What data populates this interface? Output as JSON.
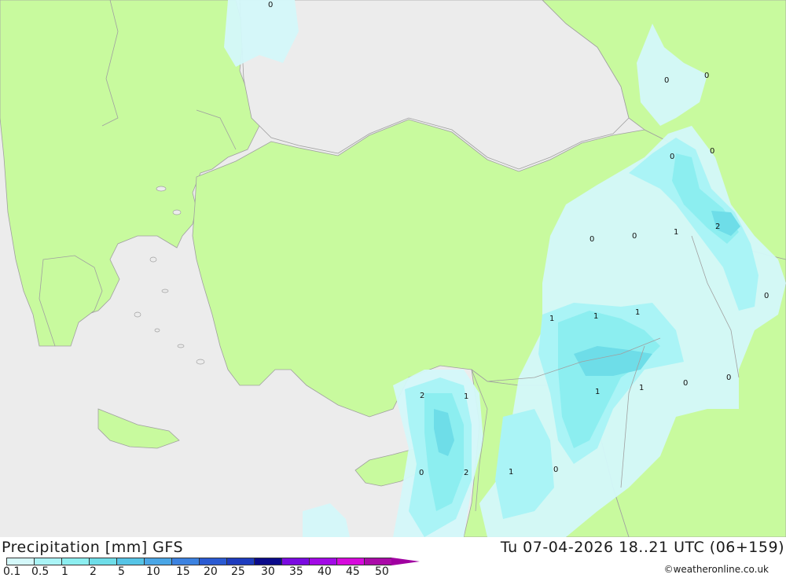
{
  "title_left": "Precipitation [mm] GFS",
  "title_right": "Tu 07-04-2026 18..21 UTC (06+159)",
  "credit": "©weatheronline.co.uk",
  "legend": {
    "ticks": [
      "0.1",
      "0.5",
      "1",
      "2",
      "5",
      "10",
      "15",
      "20",
      "25",
      "30",
      "35",
      "40",
      "45",
      "50"
    ],
    "colors": [
      "#d4f8fa",
      "#aaf4f6",
      "#8ceef0",
      "#6edde8",
      "#56c4e6",
      "#4aa6e6",
      "#3c82e0",
      "#2a5ad2",
      "#1e3cbe",
      "#0a0a8a",
      "#7a0ae0",
      "#a20ae6",
      "#d60adc",
      "#aa0aa8"
    ]
  },
  "map": {
    "colors": {
      "sea": "#ececec",
      "land": "#c8fa9e",
      "border": "#a0a0a0",
      "precip_light": "#d4f8fa",
      "precip_mid": "#aaf4f6",
      "precip_high": "#8ceef0",
      "precip_max": "#6edde8"
    },
    "labels": [
      {
        "text": "0"
      },
      {
        "text": "0"
      },
      {
        "text": "0"
      },
      {
        "text": "0"
      },
      {
        "text": "0"
      },
      {
        "text": "0"
      },
      {
        "text": "0"
      },
      {
        "text": "1"
      },
      {
        "text": "2"
      },
      {
        "text": "0"
      },
      {
        "text": "1"
      },
      {
        "text": "1"
      },
      {
        "text": "1"
      },
      {
        "text": "1"
      },
      {
        "text": "1"
      },
      {
        "text": "0"
      },
      {
        "text": "0"
      },
      {
        "text": "2"
      },
      {
        "text": "1"
      },
      {
        "text": "0"
      },
      {
        "text": "2"
      },
      {
        "text": "1"
      },
      {
        "text": "0"
      }
    ]
  }
}
